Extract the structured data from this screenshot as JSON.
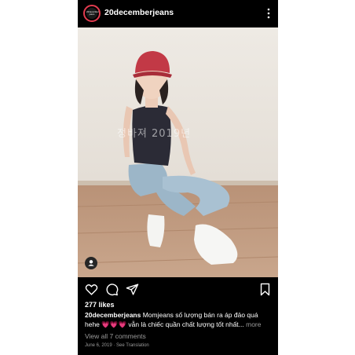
{
  "post": {
    "username": "20decemberjeans",
    "avatar_text": "20december jeans",
    "watermark": "정바져 2019년",
    "likes": "277 likes",
    "caption_user": "20decemberjeans",
    "caption_text": " Momjeans số lượng bán ra áp đảo quá hehe 💗💗💗 vẫn là chiếc quần chất lượng tốt nhất...",
    "more_label": " more",
    "comments_link": "View all 7 comments",
    "date": "June 6, 2019",
    "translation_link": "See Translation",
    "separator": " · "
  },
  "icons": {
    "more": "more-vertical-icon",
    "like": "heart-icon",
    "comment": "comment-icon",
    "share": "send-icon",
    "save": "bookmark-icon",
    "tag": "user-tag-icon"
  },
  "colors": {
    "background": "#000000",
    "text": "#ffffff",
    "secondary_text": "#9a9a9a",
    "avatar_ring": "#e23b4f"
  }
}
